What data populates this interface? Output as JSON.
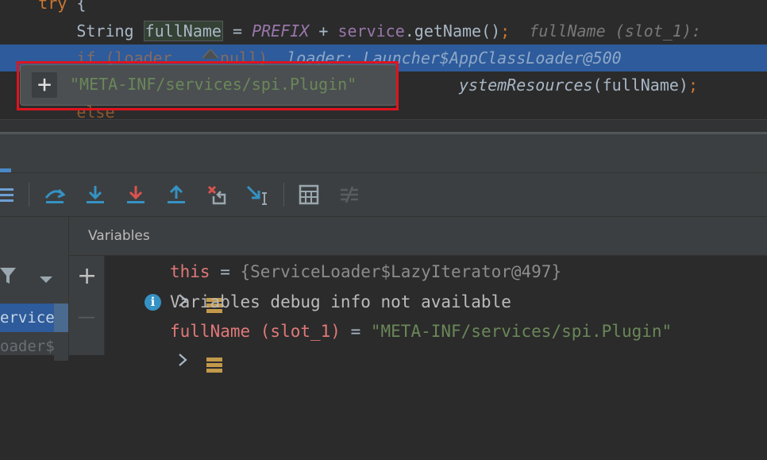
{
  "editor": {
    "line0": {
      "kw": "try",
      "brace": " {"
    },
    "line1": {
      "type": "String",
      "var": "fullName",
      "eq": " = ",
      "const": "PREFIX",
      "plus": " + ",
      "field": "service",
      "call": ".getName()",
      "semi": ";",
      "hint": "fullName (slot_1):"
    },
    "line2": {
      "code": "if (loader",
      "code2": " null)",
      "hint": "loader: Launcher$AppClassLoader@500"
    },
    "line3": {
      "method": "ystemResources",
      "args": "(fullName)",
      "semi": ";"
    },
    "line4": {
      "kw": "else"
    }
  },
  "popup": {
    "expand_label": "+",
    "value": "\"META-INF/services/spi.Plugin\""
  },
  "variables": {
    "title": "Variables",
    "rows": [
      {
        "name": "this",
        "op": " = ",
        "value": "{ServiceLoader$LazyIterator@497}"
      },
      {
        "message": "Variables debug info not available"
      },
      {
        "name": "fullName (slot_1)",
        "op": " = ",
        "value": "\"META-INF/services/spi.Plugin\""
      }
    ],
    "add_label": "+",
    "remove_label": "—"
  },
  "frames": {
    "items": [
      "erviceL",
      "oader$L"
    ]
  },
  "colors": {
    "accent": "#4a88c7",
    "highlight_line": "#2d5b9b",
    "popup_border": "#e0141e",
    "string": "#6a8759",
    "keyword": "#cc7832"
  }
}
